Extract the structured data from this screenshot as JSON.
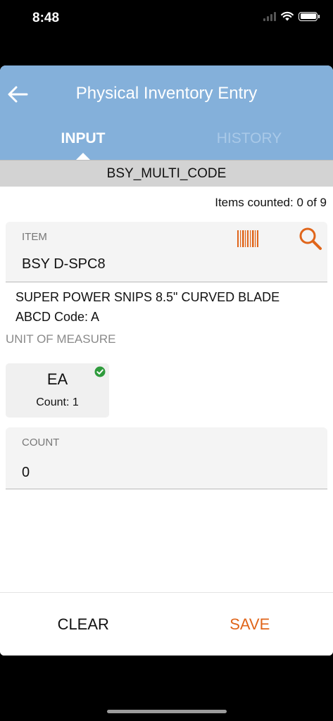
{
  "status_bar": {
    "time": "8:48"
  },
  "header": {
    "title": "Physical Inventory Entry",
    "tabs": [
      {
        "label": "INPUT",
        "active": true
      },
      {
        "label": "HISTORY",
        "active": false
      }
    ]
  },
  "code_bar": {
    "code": "BSY_MULTI_CODE"
  },
  "items_counted": "Items counted: 0 of 9",
  "item_field": {
    "label": "ITEM",
    "value": "BSY D-SPC8"
  },
  "description": {
    "line1": "SUPER POWER SNIPS 8.5\" CURVED BLADE",
    "line2": "ABCD Code: A"
  },
  "unit_of_measure": {
    "label": "UNIT OF MEASURE",
    "options": [
      {
        "name": "EA",
        "count_label": "Count: 1",
        "selected": true
      }
    ]
  },
  "count_field": {
    "label": "COUNT",
    "value": "0"
  },
  "actions": {
    "clear_label": "CLEAR",
    "save_label": "SAVE"
  },
  "colors": {
    "header_bg": "#84b0da",
    "accent_orange": "#e0651a",
    "check_green": "#2e9b3c"
  },
  "icons": [
    "back-arrow-icon",
    "barcode-icon",
    "search-icon",
    "check-circle-icon",
    "wifi-icon",
    "battery-icon",
    "signal-icon"
  ]
}
